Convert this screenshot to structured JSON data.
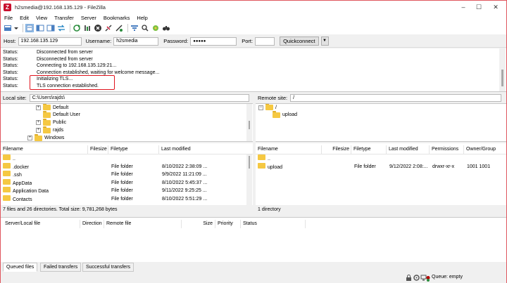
{
  "titlebar": {
    "title": "h2smedia@192.168.135.129 - FileZilla",
    "app_icon": "Z",
    "minimize": "–",
    "maximize": "☐",
    "close": "✕"
  },
  "menu": [
    "File",
    "Edit",
    "View",
    "Transfer",
    "Server",
    "Bookmarks",
    "Help"
  ],
  "toolbar": {
    "icons": [
      "site-manager-icon",
      "dropdown-arrow-icon",
      "toggle-log-icon",
      "toggle-local-tree-icon",
      "toggle-remote-tree-icon",
      "toggle-queue-icon",
      "refresh-icon",
      "process-queue-icon",
      "cancel-icon",
      "disconnect-icon",
      "reconnect-icon",
      "filter-icon",
      "search-icon",
      "compare-icon",
      "find-files-icon"
    ]
  },
  "quickconnect": {
    "host_label": "Host:",
    "host_value": "192.168.135.129",
    "username_label": "Username:",
    "username_value": "h2smedia",
    "password_label": "Password:",
    "password_value": "●●●●●",
    "port_label": "Port:",
    "port_value": "",
    "button_label": "Quickconnect",
    "dropdown_glyph": "▼"
  },
  "log": [
    {
      "key": "Status:",
      "msg": "Disconnected from server"
    },
    {
      "key": "Status:",
      "msg": "Disconnected from server"
    },
    {
      "key": "Status:",
      "msg": "Connecting to 192.168.135.129:21..."
    },
    {
      "key": "Status:",
      "msg": "Connection established, waiting for welcome message..."
    },
    {
      "key": "Status:",
      "msg": "Initializing TLS..."
    },
    {
      "key": "Status:",
      "msg": "TLS connection established."
    }
  ],
  "local": {
    "site_label": "Local site:",
    "site_path": "C:\\Users\\rajds\\",
    "tree": [
      {
        "label": "Default",
        "expander": "+"
      },
      {
        "label": "Default User",
        "expander": ""
      },
      {
        "label": "Public",
        "expander": "+"
      },
      {
        "label": "rajds",
        "expander": "+"
      },
      {
        "label": "Windows",
        "expander": "+"
      }
    ],
    "columns": [
      "Filename",
      "Filesize",
      "Filetype",
      "Last modified"
    ],
    "files": [
      {
        "name": "..",
        "size": "",
        "type": "",
        "modified": ""
      },
      {
        "name": ".docker",
        "size": "",
        "type": "File folder",
        "modified": "8/10/2022 2:38:09 ..."
      },
      {
        "name": ".ssh",
        "size": "",
        "type": "File folder",
        "modified": "9/9/2022 11:21:09 ..."
      },
      {
        "name": "AppData",
        "size": "",
        "type": "File folder",
        "modified": "8/10/2022 5:45:37 ..."
      },
      {
        "name": "Application Data",
        "size": "",
        "type": "File folder",
        "modified": "9/11/2022 9:25:25 ..."
      },
      {
        "name": "Contacts",
        "size": "",
        "type": "File folder",
        "modified": "8/10/2022 5:51:29 ..."
      }
    ],
    "status": "7 files and 26 directories. Total size: 9,781,268 bytes"
  },
  "remote": {
    "site_label": "Remote site:",
    "site_path": "/",
    "tree": [
      {
        "label": "/",
        "expander": "−"
      },
      {
        "label": "upload",
        "expander": ""
      }
    ],
    "columns": [
      "Filename",
      "Filesize",
      "Filetype",
      "Last modified",
      "Permissions",
      "Owner/Group"
    ],
    "files": [
      {
        "name": "..",
        "size": "",
        "type": "",
        "modified": "",
        "perms": "",
        "owner": ""
      },
      {
        "name": "upload",
        "size": "",
        "type": "File folder",
        "modified": "9/12/2022 2:08:...",
        "perms": "drwxr-xr-x",
        "owner": "1001 1001"
      }
    ],
    "status": "1 directory"
  },
  "queue": {
    "columns": [
      "Server/Local file",
      "Direction",
      "Remote file",
      "Size",
      "Priority",
      "Status"
    ]
  },
  "tabs": [
    "Queued files",
    "Failed transfers",
    "Successful transfers"
  ],
  "statusbar": {
    "queue_text": "Queue: empty",
    "icons": [
      "lock-icon",
      "gear-icon",
      "network-icon",
      "led-red-icon",
      "led-green-icon"
    ]
  },
  "colors": {
    "accent_border": "#e0565e",
    "highlight_box": "#e0141e",
    "folder": "#f5c842"
  }
}
